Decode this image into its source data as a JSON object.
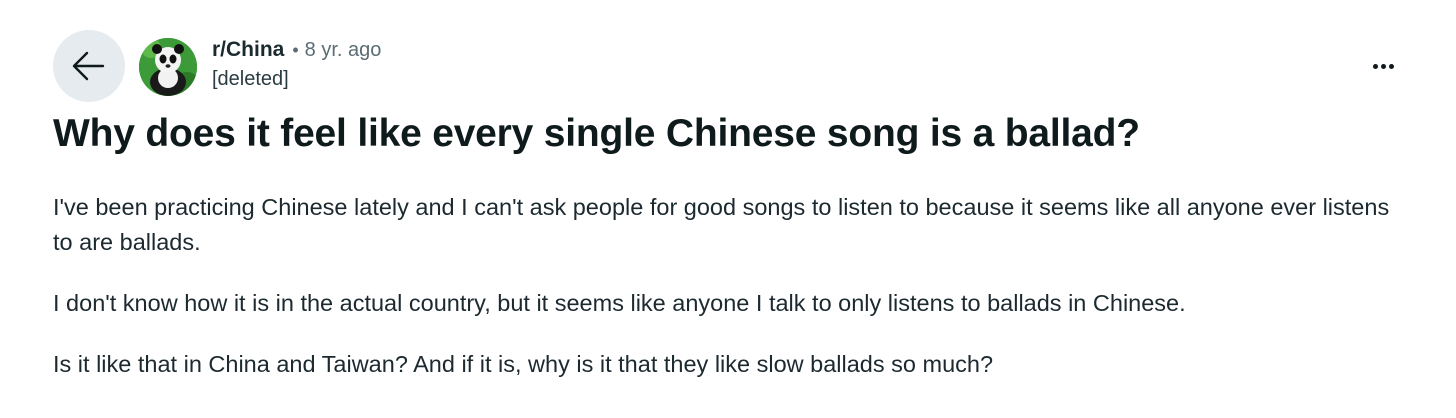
{
  "post": {
    "subreddit": "r/China",
    "separator": "•",
    "age": "8 yr. ago",
    "author": "[deleted]",
    "title": "Why does it feel like every single Chinese song is a ballad?",
    "paragraphs": [
      "I've been practicing Chinese lately and I can't ask people for good songs to listen to because it seems like all anyone ever listens to are ballads.",
      "I don't know how it is in the actual country, but it seems like anyone I talk to only listens to ballads in Chinese.",
      "Is it like that in China and Taiwan? And if it is, why is it that they like slow ballads so much?"
    ]
  },
  "icons": {
    "back": "arrow-left-icon",
    "avatar": "panda-avatar",
    "overflow": "more-horizontal-icon"
  },
  "colors": {
    "back_button_bg": "#e5ebee",
    "text_primary": "#0f1a1c",
    "text_secondary": "#5c6c74"
  }
}
